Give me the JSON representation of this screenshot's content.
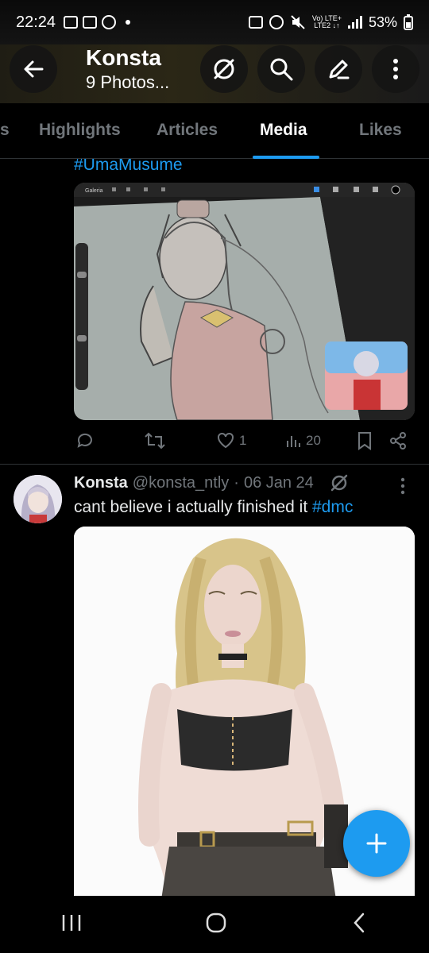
{
  "status_bar": {
    "time": "22:24",
    "network_top": "Vo) LTE+",
    "network_bottom": "LTE2 ↓↑",
    "battery": "53%"
  },
  "header": {
    "title": "Konsta",
    "subtitle": "9 Photos..."
  },
  "tabs": [
    {
      "label": "s"
    },
    {
      "label": "Highlights"
    },
    {
      "label": "Articles"
    },
    {
      "label": "Media",
      "active": true
    },
    {
      "label": "Likes"
    }
  ],
  "post1": {
    "hashtag": "#UmaMusume",
    "app_label": "Galeria",
    "actions": {
      "reply": "",
      "repost": "",
      "likes": "1",
      "views": "20"
    }
  },
  "post2": {
    "name": "Konsta",
    "handle": "@konsta_ntly",
    "separator": "·",
    "date": "06 Jan 24",
    "text": "cant believe i actually finished it ",
    "hashtag": "#dmc"
  },
  "colors": {
    "accent": "#1d9bf0",
    "background": "#000000",
    "muted_text": "#71767b"
  },
  "icons": {
    "back": "arrow-left-icon",
    "grok": "grok-icon",
    "search": "search-icon",
    "edit": "pencil-icon",
    "more": "more-vertical-icon",
    "fab": "plus-icon"
  }
}
